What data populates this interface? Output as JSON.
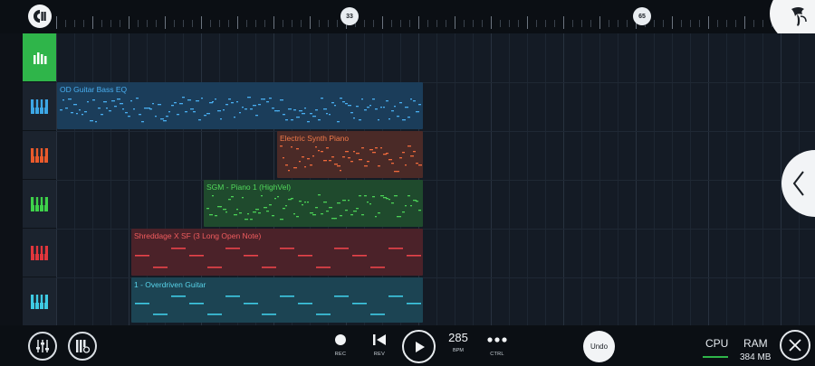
{
  "timeline": {
    "markers": [
      {
        "label": "33"
      },
      {
        "label": "65"
      }
    ]
  },
  "tracks": [
    {
      "icon": "mixer-bars-icon",
      "color": "#ffffff"
    },
    {
      "icon": "piano-keys-icon",
      "color": "#3da7e6"
    },
    {
      "icon": "piano-keys-icon",
      "color": "#ea5a2b"
    },
    {
      "icon": "piano-keys-icon",
      "color": "#3ed14a"
    },
    {
      "icon": "piano-keys-icon",
      "color": "#e2363c"
    },
    {
      "icon": "piano-keys-icon",
      "color": "#3ecbe4"
    }
  ],
  "clips": [
    {
      "name": "OD Guitar Bass EQ",
      "text_color": "#49aef0",
      "fill": "#1b3d5a",
      "note_color": "#49aef0",
      "pattern": "dense"
    },
    {
      "name": "Electric Synth Piano",
      "text_color": "#f07a4a",
      "fill": "#4a2a27",
      "note_color": "#ef6a3c",
      "pattern": "dense"
    },
    {
      "name": "SGM - Piano 1 (HighVel)",
      "text_color": "#52d85b",
      "fill": "#1f4a2d",
      "note_color": "#4bd156",
      "pattern": "dense"
    },
    {
      "name": "Shreddage X SF (3 Long Open Note)",
      "text_color": "#f05c5e",
      "fill": "#4b2229",
      "note_color": "#e8434a",
      "pattern": "long"
    },
    {
      "name": "1 - Overdriven Guitar",
      "text_color": "#58d4ea",
      "fill": "#1c4453",
      "note_color": "#3fcbe6",
      "pattern": "long"
    }
  ],
  "transport": {
    "rec_label": "REC",
    "rev_label": "REV",
    "bpm_value": "285",
    "bpm_label": "BPM",
    "ctrl_label": "CTRL",
    "undo_label": "Undo"
  },
  "meters": {
    "cpu_label": "CPU",
    "ram_label": "RAM",
    "ram_value": "384 MB"
  },
  "colors": {
    "accent_green": "#2fb54a",
    "background": "#121820"
  }
}
